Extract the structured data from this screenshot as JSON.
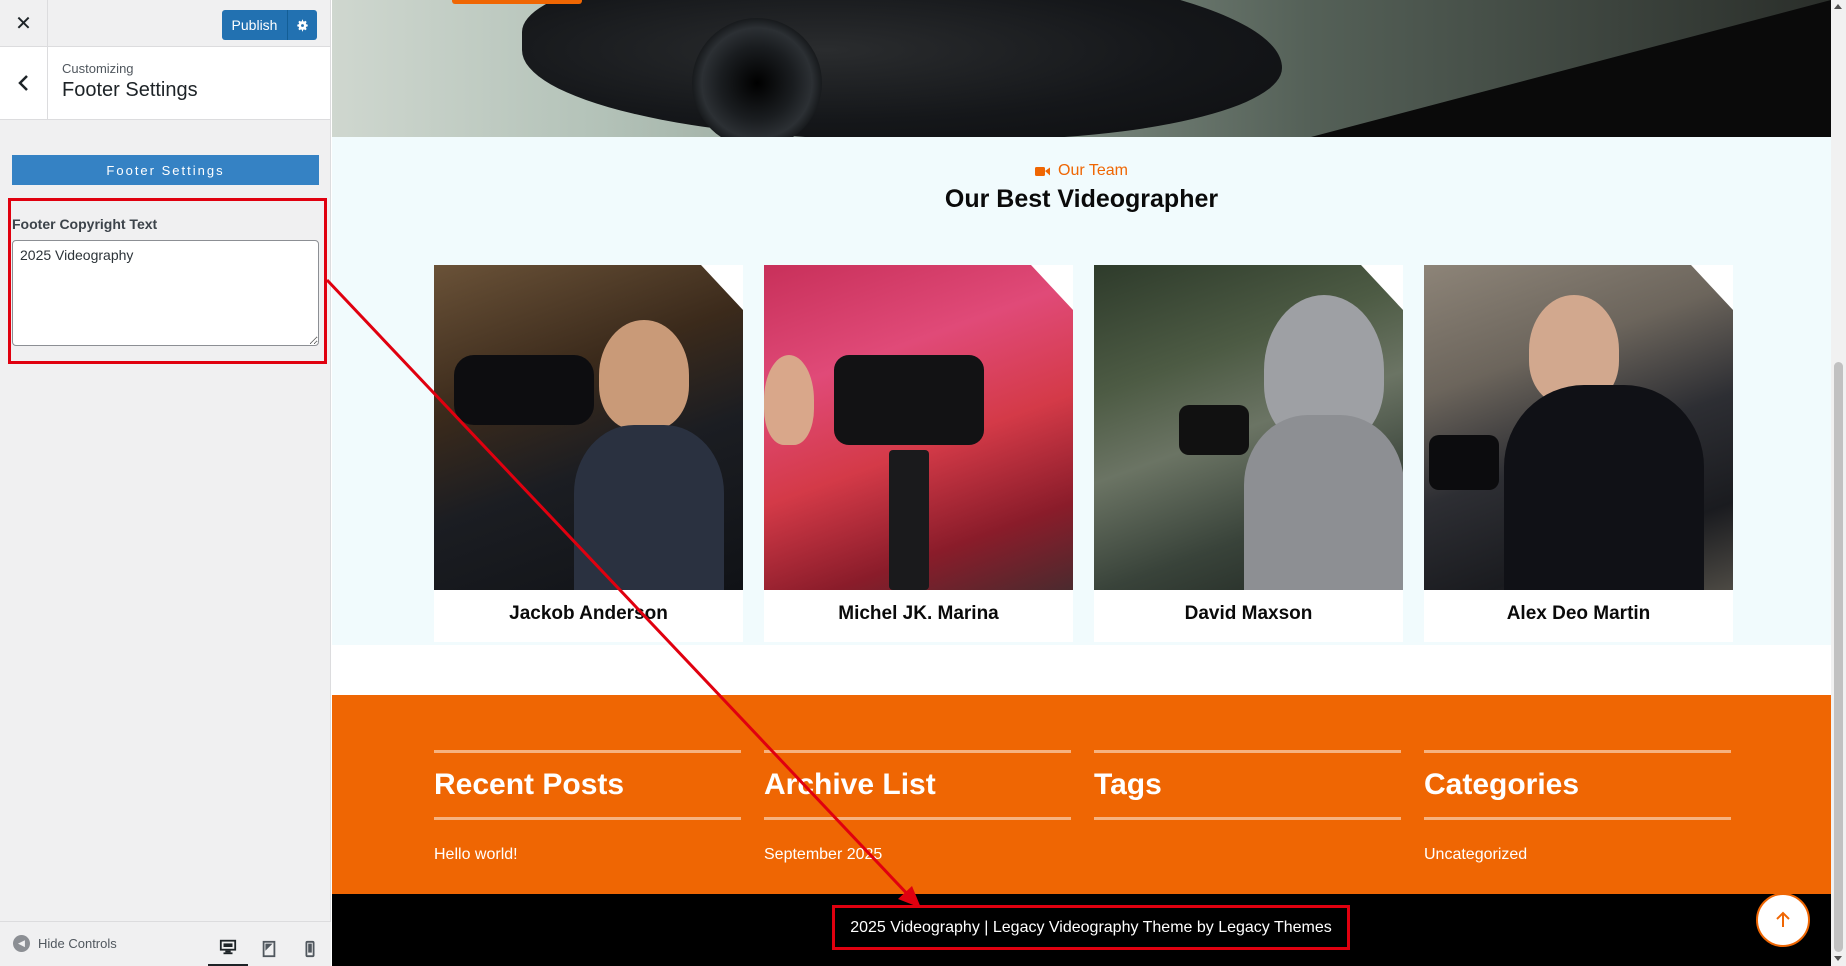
{
  "customizer": {
    "close_icon": "close-icon",
    "publish_label": "Publish",
    "settings_icon": "gear-icon",
    "customizing_label": "Customizing",
    "section_title": "Footer Settings",
    "panel_banner": "Footer Settings",
    "control_label": "Footer Copyright Text",
    "control_value": "2025 Videography",
    "hide_controls_label": "Hide Controls",
    "devices": [
      "desktop-icon",
      "tablet-icon",
      "mobile-icon"
    ],
    "active_device": "desktop"
  },
  "preview": {
    "team": {
      "kicker": "Our Team",
      "title": "Our Best Videographer",
      "members": [
        {
          "name": "Jackob Anderson"
        },
        {
          "name": "Michel JK. Marina"
        },
        {
          "name": "David Maxson"
        },
        {
          "name": "Alex Deo Martin"
        }
      ]
    },
    "footer": {
      "columns": [
        {
          "heading": "Recent Posts",
          "link": "Hello world!"
        },
        {
          "heading": "Archive List",
          "link": "September 2025"
        },
        {
          "heading": "Tags",
          "link": ""
        },
        {
          "heading": "Categories",
          "link": "Uncategorized"
        }
      ],
      "copyright": "2025 Videography | Legacy Videography Theme by Legacy Themes"
    }
  },
  "colors": {
    "accent": "#ef6603",
    "wp_blue": "#2271b1",
    "annotation_red": "#e0000f"
  }
}
